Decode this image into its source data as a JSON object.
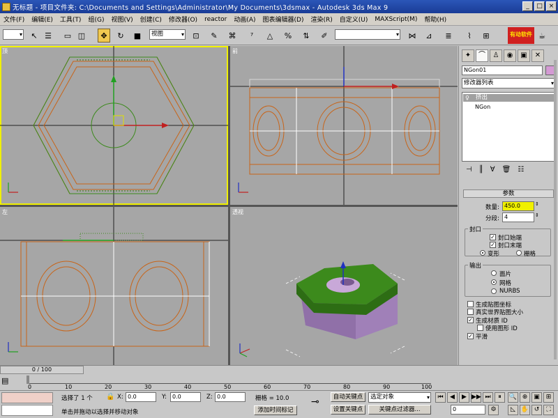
{
  "window": {
    "title": "无标题    - 项目文件夹: C:\\Documents and Settings\\Administrator\\My Documents\\3dsmax    - Autodesk 3ds Max 9"
  },
  "menu": [
    "文件(F)",
    "编辑(E)",
    "工具(T)",
    "组(G)",
    "视图(V)",
    "创建(C)",
    "修改器(O)",
    "reactor",
    "动画(A)",
    "图表编辑器(D)",
    "渲染(R)",
    "自定义(U)",
    "MAXScript(M)",
    "帮助(H)"
  ],
  "toolbar": {
    "ref_coord": "视图",
    "named_sel": "",
    "logo_text": "有动软件"
  },
  "viewports": {
    "top_label": "顶",
    "front_label": "前",
    "left_label": "左",
    "persp_label": "透视"
  },
  "command_panel": {
    "object_name": "NGon01",
    "modifier_list": "修改器列表",
    "stack_items": [
      "挤出",
      "NGon"
    ],
    "params_title": "参数",
    "amount_label": "数量:",
    "amount_value": "450.0",
    "segments_label": "分段:",
    "segments_value": "4",
    "capping_title": "封口",
    "cap_start": "封口始端",
    "cap_end": "封口末端",
    "morph": "变形",
    "grid": "栅格",
    "output_title": "输出",
    "patch": "面片",
    "mesh": "网格",
    "nurbs": "NURBS",
    "gen_map": "生成贴图坐标",
    "real_world": "真实世界贴图大小",
    "gen_mat_ids": "生成材质 ID",
    "use_shape_ids": "使用图形 ID",
    "smooth": "平滑"
  },
  "timeline": {
    "slider": "0 / 100",
    "ticks": [
      "0",
      "10",
      "20",
      "30",
      "40",
      "50",
      "60",
      "70",
      "80",
      "90",
      "100"
    ]
  },
  "status": {
    "selected": "选择了 1 个",
    "x_label": "X:",
    "x_val": "0.0",
    "y_label": "Y:",
    "y_val": "0.0",
    "z_label": "Z:",
    "z_val": "0.0",
    "grid": "栅格 = 10.0",
    "auto_key": "自动关键点",
    "set_key": "设置关键点",
    "key_filter_sel": "选定对象",
    "key_filters": "关键点过滤器...",
    "prompt": "单击并拖动以选择并移动对象",
    "add_time_tag": "添加时间标记",
    "frame": "0"
  },
  "colors": {
    "accent": "#f0c850",
    "active_vp": "#f0f000",
    "hexTop": "#3c8a1c",
    "hexSide": "#a080b8"
  }
}
